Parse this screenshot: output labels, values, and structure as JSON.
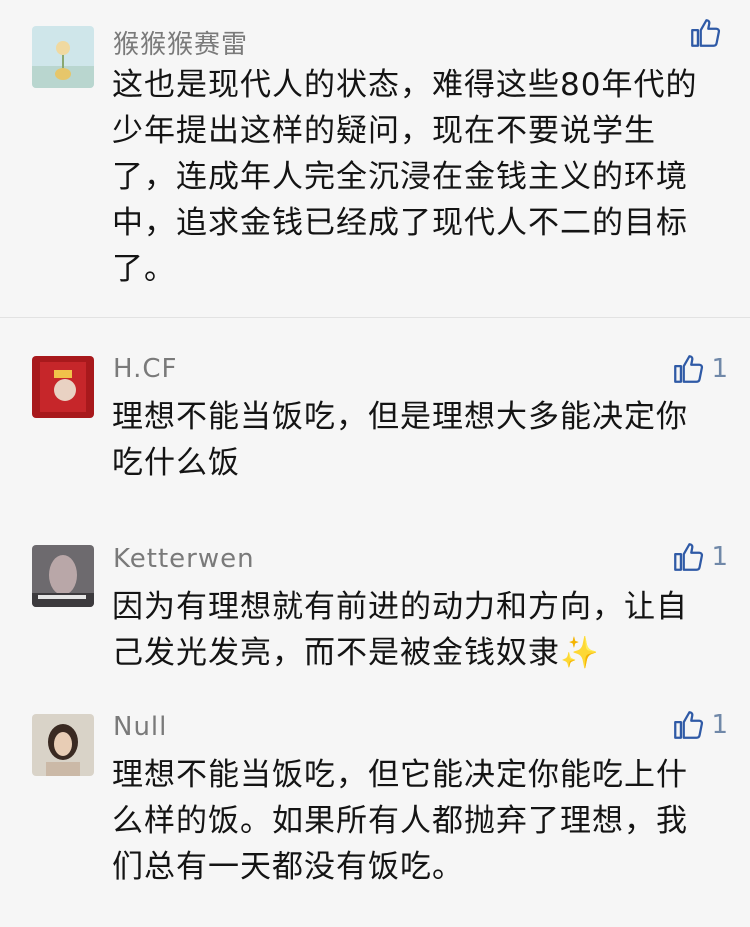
{
  "colors": {
    "background": "#f6f6f6",
    "name": "#7a7a7a",
    "like": "#2f5aa6",
    "text": "#141414"
  },
  "comments": [
    {
      "name": "猴猴猴赛雷",
      "text": "这也是现代人的状态，难得这些80年代的少年提出这样的疑问，现在不要说学生了，连成年人完全沉浸在金钱主义的环境中，追求金钱已经成了现代人不二的目标了。",
      "likes": "",
      "icons": {
        "like": "thumbs-up-icon",
        "avatar": "avatar"
      }
    },
    {
      "name": "H.CF",
      "text": "理想不能当饭吃，但是理想大多能决定你吃什么饭",
      "likes": "1",
      "icons": {
        "like": "thumbs-up-icon",
        "avatar": "avatar"
      }
    },
    {
      "name": "Ketterwen",
      "text": "因为有理想就有前进的动力和方向，让自己发光发亮，而不是被金钱奴隶✨",
      "likes": "1",
      "icons": {
        "like": "thumbs-up-icon",
        "avatar": "avatar"
      }
    },
    {
      "name": "Null",
      "text": "理想不能当饭吃，但它能决定你能吃上什么样的饭。如果所有人都抛弃了理想，我们总有一天都没有饭吃。",
      "likes": "1",
      "icons": {
        "like": "thumbs-up-icon",
        "avatar": "avatar"
      }
    }
  ]
}
